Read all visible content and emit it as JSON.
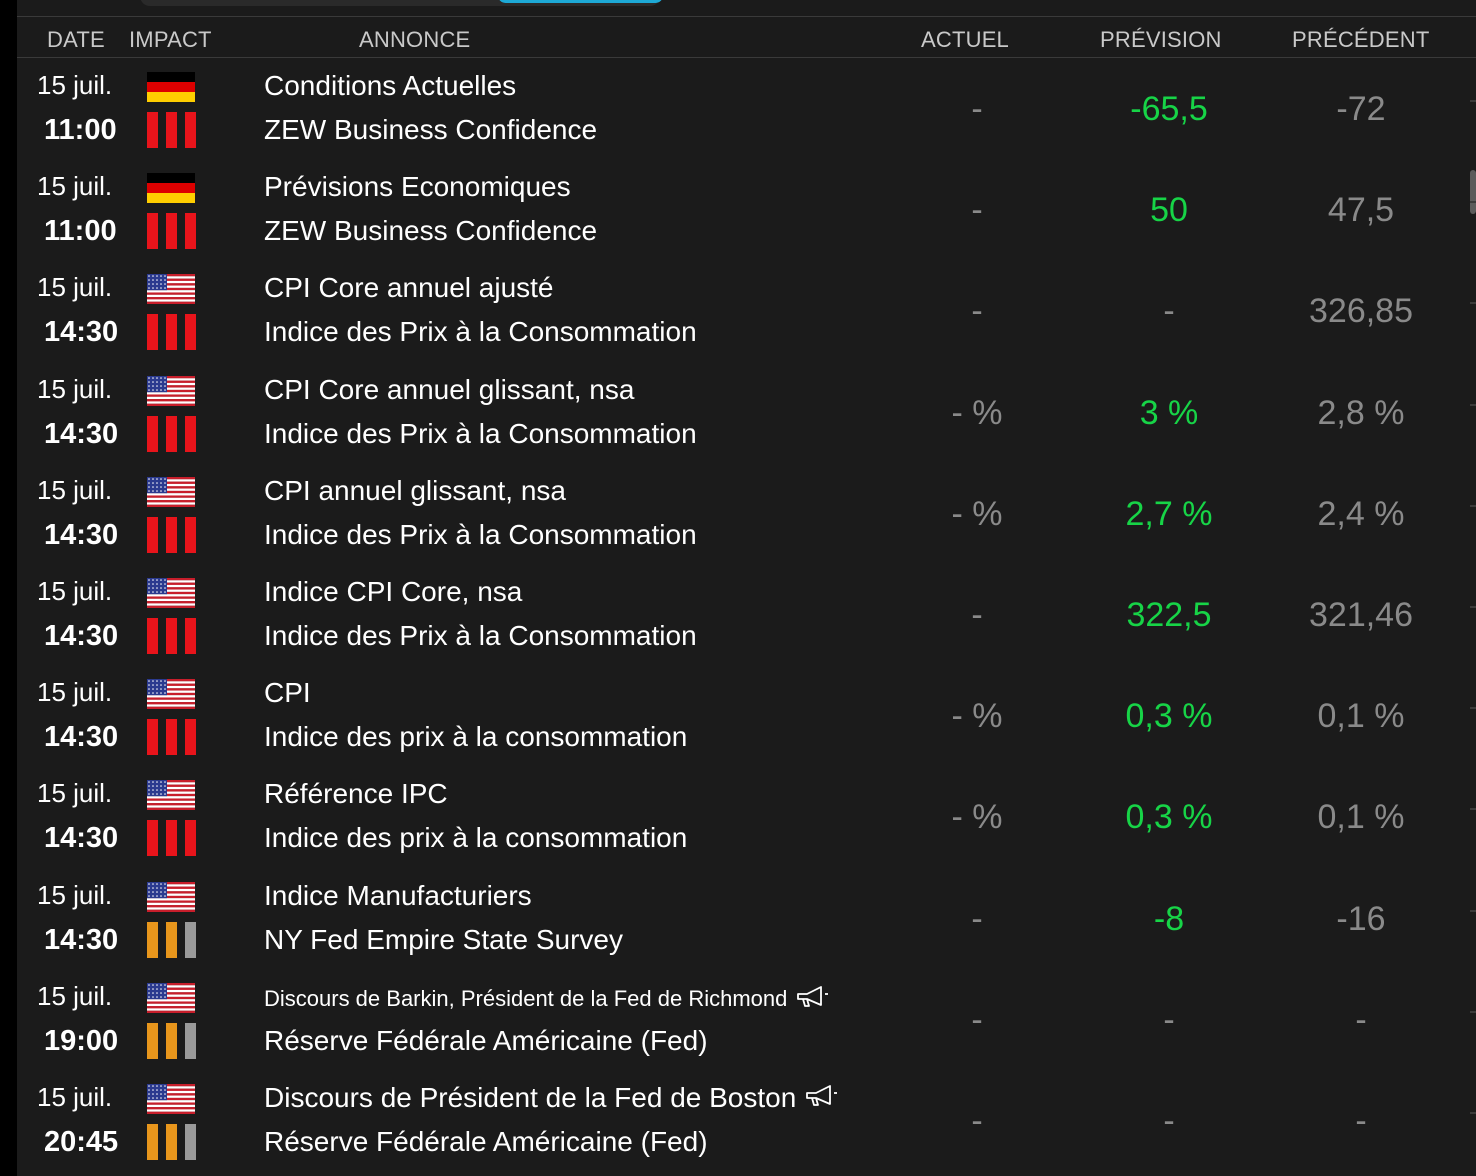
{
  "header": {
    "date": "DATE",
    "impact": "IMPACT",
    "announcement": "ANNONCE",
    "actual": "ACTUEL",
    "forecast": "PRÉVISION",
    "previous": "PRÉCÉDENT"
  },
  "colors": {
    "background": "#1b1b1b",
    "positive": "#17d447",
    "muted": "#8a8a8a",
    "impact_high": "#e8141b",
    "impact_medium": "#e8961c",
    "impact_low": "#9a9a9a",
    "search_accent": "#1da9d6"
  },
  "events": [
    {
      "date": "15 juil.",
      "time": "11:00",
      "country": "Germany",
      "flag_icon": "germany-flag-icon",
      "impact": "high",
      "title": "Conditions Actuelles",
      "subtitle": "ZEW Business Confidence",
      "actual": "-",
      "forecast": "-65,5",
      "previous": "-72",
      "speech": false
    },
    {
      "date": "15 juil.",
      "time": "11:00",
      "country": "Germany",
      "flag_icon": "germany-flag-icon",
      "impact": "high",
      "title": "Prévisions Economiques",
      "subtitle": "ZEW Business Confidence",
      "actual": "-",
      "forecast": "50",
      "previous": "47,5",
      "speech": false
    },
    {
      "date": "15 juil.",
      "time": "14:30",
      "country": "United States",
      "flag_icon": "usa-flag-icon",
      "impact": "high",
      "title": "CPI Core annuel ajusté",
      "subtitle": "Indice des Prix à la Consommation",
      "actual": "-",
      "forecast": "-",
      "previous": "326,85",
      "speech": false
    },
    {
      "date": "15 juil.",
      "time": "14:30",
      "country": "United States",
      "flag_icon": "usa-flag-icon",
      "impact": "high",
      "title": "CPI Core annuel glissant, nsa",
      "subtitle": "Indice des Prix à la Consommation",
      "actual": "- %",
      "forecast": "3 %",
      "previous": "2,8 %",
      "speech": false
    },
    {
      "date": "15 juil.",
      "time": "14:30",
      "country": "United States",
      "flag_icon": "usa-flag-icon",
      "impact": "high",
      "title": "CPI annuel glissant, nsa",
      "subtitle": "Indice des Prix à la Consommation",
      "actual": "- %",
      "forecast": "2,7 %",
      "previous": "2,4 %",
      "speech": false
    },
    {
      "date": "15 juil.",
      "time": "14:30",
      "country": "United States",
      "flag_icon": "usa-flag-icon",
      "impact": "high",
      "title": "Indice CPI Core, nsa",
      "subtitle": "Indice des Prix à la Consommation",
      "actual": "-",
      "forecast": "322,5",
      "previous": "321,46",
      "speech": false
    },
    {
      "date": "15 juil.",
      "time": "14:30",
      "country": "United States",
      "flag_icon": "usa-flag-icon",
      "impact": "high",
      "title": "CPI",
      "subtitle": "Indice des prix à la consommation",
      "actual": "- %",
      "forecast": "0,3 %",
      "previous": "0,1 %",
      "speech": false
    },
    {
      "date": "15 juil.",
      "time": "14:30",
      "country": "United States",
      "flag_icon": "usa-flag-icon",
      "impact": "high",
      "title": "Référence IPC",
      "subtitle": "Indice des prix à la consommation",
      "actual": "- %",
      "forecast": "0,3 %",
      "previous": "0,1 %",
      "speech": false
    },
    {
      "date": "15 juil.",
      "time": "14:30",
      "country": "United States",
      "flag_icon": "usa-flag-icon",
      "impact": "medium",
      "title": "Indice Manufacturiers",
      "subtitle": "NY Fed Empire State Survey",
      "actual": "-",
      "forecast": "-8",
      "previous": "-16",
      "speech": false
    },
    {
      "date": "15 juil.",
      "time": "19:00",
      "country": "United States",
      "flag_icon": "usa-flag-icon",
      "impact": "medium",
      "title": "Discours de Barkin, Président de la Fed de Richmond",
      "subtitle": "Réserve Fédérale Américaine (Fed)",
      "actual": "-",
      "forecast": "-",
      "previous": "-",
      "speech": true,
      "small_title": true
    },
    {
      "date": "15 juil.",
      "time": "20:45",
      "country": "United States",
      "flag_icon": "usa-flag-icon",
      "impact": "medium",
      "title": "Discours de Président de la Fed de Boston",
      "subtitle": "Réserve Fédérale Américaine (Fed)",
      "actual": "-",
      "forecast": "-",
      "previous": "-",
      "speech": true
    }
  ]
}
